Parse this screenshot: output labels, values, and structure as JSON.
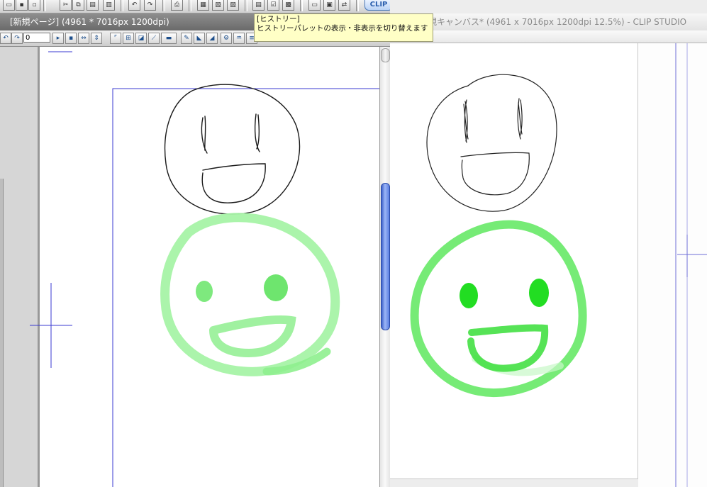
{
  "app": {
    "left_window_title": "[新規ページ] (4961 * 7016px 1200dpi)",
    "right_window_title": "規キャンバス* (4961 x 7016px 1200dpi 12.5%)  - CLIP STUDIO"
  },
  "toolbar_top": {
    "logo_text": "CLIP",
    "buttons": [
      {
        "name": "open-file-icon",
        "glyph": "▭"
      },
      {
        "name": "save-icon",
        "glyph": "▪"
      },
      {
        "name": "save-as-icon",
        "glyph": "▫"
      },
      {
        "name": "cut-icon",
        "glyph": "✂"
      },
      {
        "name": "copy-icon",
        "glyph": "⧉"
      },
      {
        "name": "paste-icon",
        "glyph": "▤"
      },
      {
        "name": "delete-icon",
        "glyph": "▥"
      },
      {
        "name": "undo-icon",
        "glyph": "↶"
      },
      {
        "name": "redo-icon",
        "glyph": "↷"
      },
      {
        "name": "print-icon",
        "glyph": "⎙"
      },
      {
        "name": "layer-icon",
        "glyph": "▦"
      },
      {
        "name": "layer-props-icon",
        "glyph": "▧"
      },
      {
        "name": "layer-settings-icon",
        "glyph": "▨"
      },
      {
        "name": "history-icon",
        "glyph": "▤"
      },
      {
        "name": "checklist-icon",
        "glyph": "☑"
      },
      {
        "name": "color-palette-icon",
        "glyph": "▩"
      },
      {
        "name": "material-icon",
        "glyph": "▭"
      },
      {
        "name": "window-icon",
        "glyph": "▣"
      },
      {
        "name": "swap-icon",
        "glyph": "⇄"
      }
    ]
  },
  "view_toolbar": {
    "rotation_value": "0",
    "buttons": [
      {
        "name": "rotate-left-icon",
        "glyph": "↶"
      },
      {
        "name": "rotate-right-icon",
        "glyph": "↷"
      },
      {
        "name": "play-icon",
        "glyph": "▸"
      },
      {
        "name": "small-square-icon",
        "glyph": "▪"
      },
      {
        "name": "flip-horizontal-icon",
        "glyph": "⇔"
      },
      {
        "name": "flip-vertical-icon",
        "glyph": "⇕"
      },
      {
        "name": "crop-marks-icon",
        "glyph": "⌜"
      },
      {
        "name": "grid-icon",
        "glyph": "⊞"
      },
      {
        "name": "ruler-icon",
        "glyph": "◪"
      },
      {
        "name": "snap-icon",
        "glyph": "⟋"
      },
      {
        "name": "canvas-icon",
        "glyph": "▬"
      },
      {
        "name": "pen-icon",
        "glyph": "✎"
      },
      {
        "name": "triangle-ruler-icon",
        "glyph": "◣"
      },
      {
        "name": "perspective-icon",
        "glyph": "◢"
      },
      {
        "name": "gear-icon",
        "glyph": "⚙"
      },
      {
        "name": "brush-icon",
        "glyph": "♒"
      },
      {
        "name": "lines-icon",
        "glyph": "≡"
      }
    ]
  },
  "tooltip": {
    "title": "[ヒストリー]",
    "body": "ヒストリーパレットの表示・非表示を切り替えます"
  },
  "colors": {
    "guide_blue": "#3a3ad0",
    "light_green": "#9af29a",
    "bright_green": "#2fe02f",
    "scroll_thumb": "#6f8fe8"
  }
}
